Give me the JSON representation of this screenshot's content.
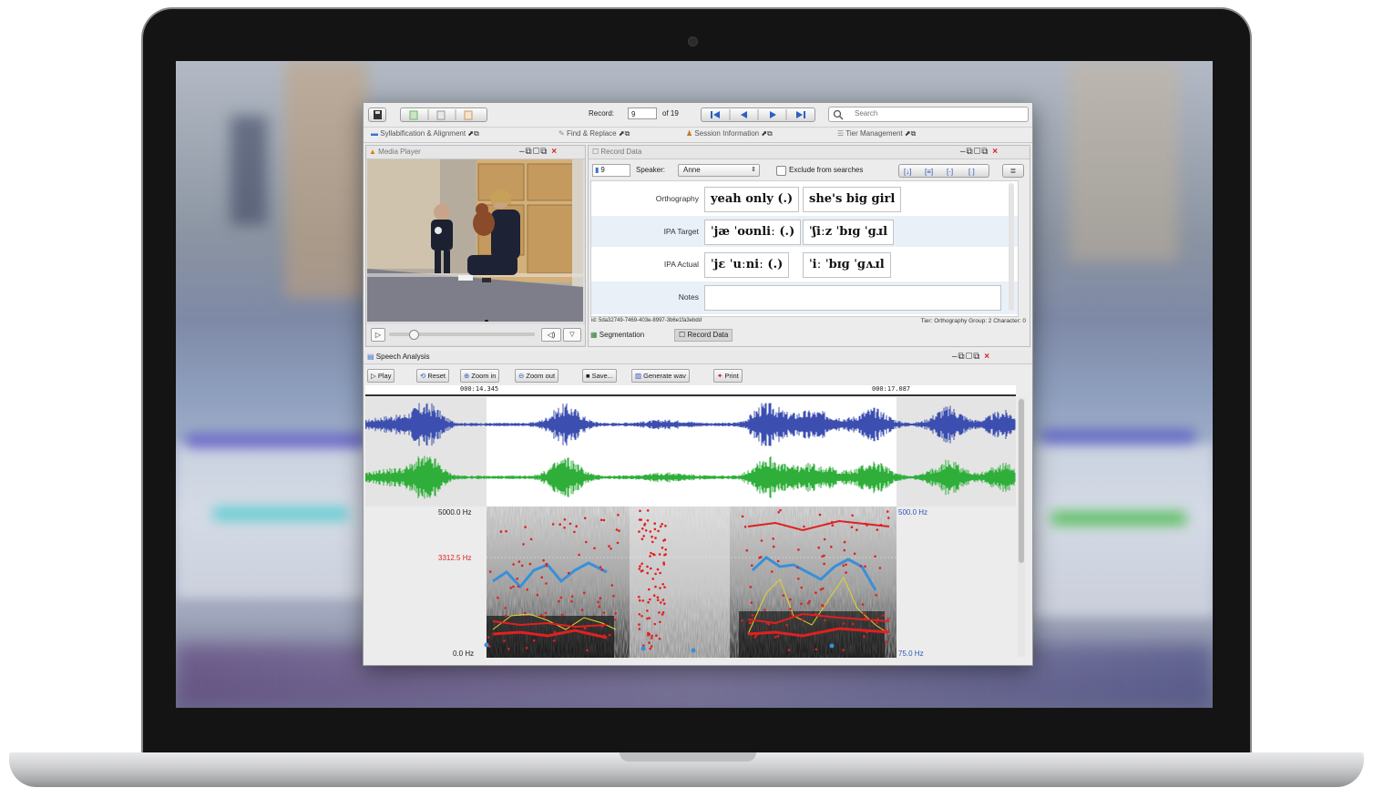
{
  "toolbar": {
    "record_label": "Record:",
    "record_value": "9",
    "record_of": "of 19",
    "search_placeholder": "Search"
  },
  "tabs": [
    {
      "label": "Syllabification & Alignment"
    },
    {
      "label": "Find & Replace"
    },
    {
      "label": "Session Information"
    },
    {
      "label": "Tier Management"
    }
  ],
  "media_player": {
    "title": "Media Player"
  },
  "record_data": {
    "title": "Record Data",
    "record_number": "9",
    "speaker_label": "Speaker:",
    "speaker_value": "Anne",
    "exclude_label": "Exclude from searches",
    "tiers": [
      {
        "label": "Orthography",
        "groups": [
          "yeah only (.)",
          "she's big girl"
        ]
      },
      {
        "label": "IPA Target",
        "groups": [
          "ˈjæ ˈoʊnliː (.)",
          "ˈʃiːz ˈbɪɡ ˈɡɹl"
        ]
      },
      {
        "label": "IPA Actual",
        "groups": [
          "ˈjɛ ˈuːniː (.)",
          "ˈiː ˈbɪɡ ˈɡʌɹl"
        ]
      },
      {
        "label": "Notes",
        "groups": [
          ""
        ]
      }
    ],
    "record_id": "id: 5da32749-7469-403e-8997-3b6e1fa3ebdd",
    "status": "Tier: Orthography Group: 2 Character: 0",
    "bottom_tabs": [
      "Segmentation",
      "Record Data"
    ]
  },
  "speech_analysis": {
    "title": "Speech Analysis",
    "buttons": [
      "Play",
      "Reset",
      "Zoom in",
      "Zoom out",
      "Save...",
      "Generate wav",
      "Print"
    ],
    "time_start": "000:14.345",
    "time_end": "000:17.087",
    "hz_left_top": "5000.0 Hz",
    "hz_left_mid": "3312.5 Hz",
    "hz_left_bottom": "0.0 Hz",
    "hz_right_top": "500.0 Hz",
    "hz_right_bottom": "75.0 Hz"
  },
  "colors": {
    "waveform_top": "#3c4fb0",
    "waveform_bottom": "#2fae3a",
    "formant": "#e02020",
    "pitch": "#3a8fd8",
    "intensity": "#e8d22a"
  }
}
